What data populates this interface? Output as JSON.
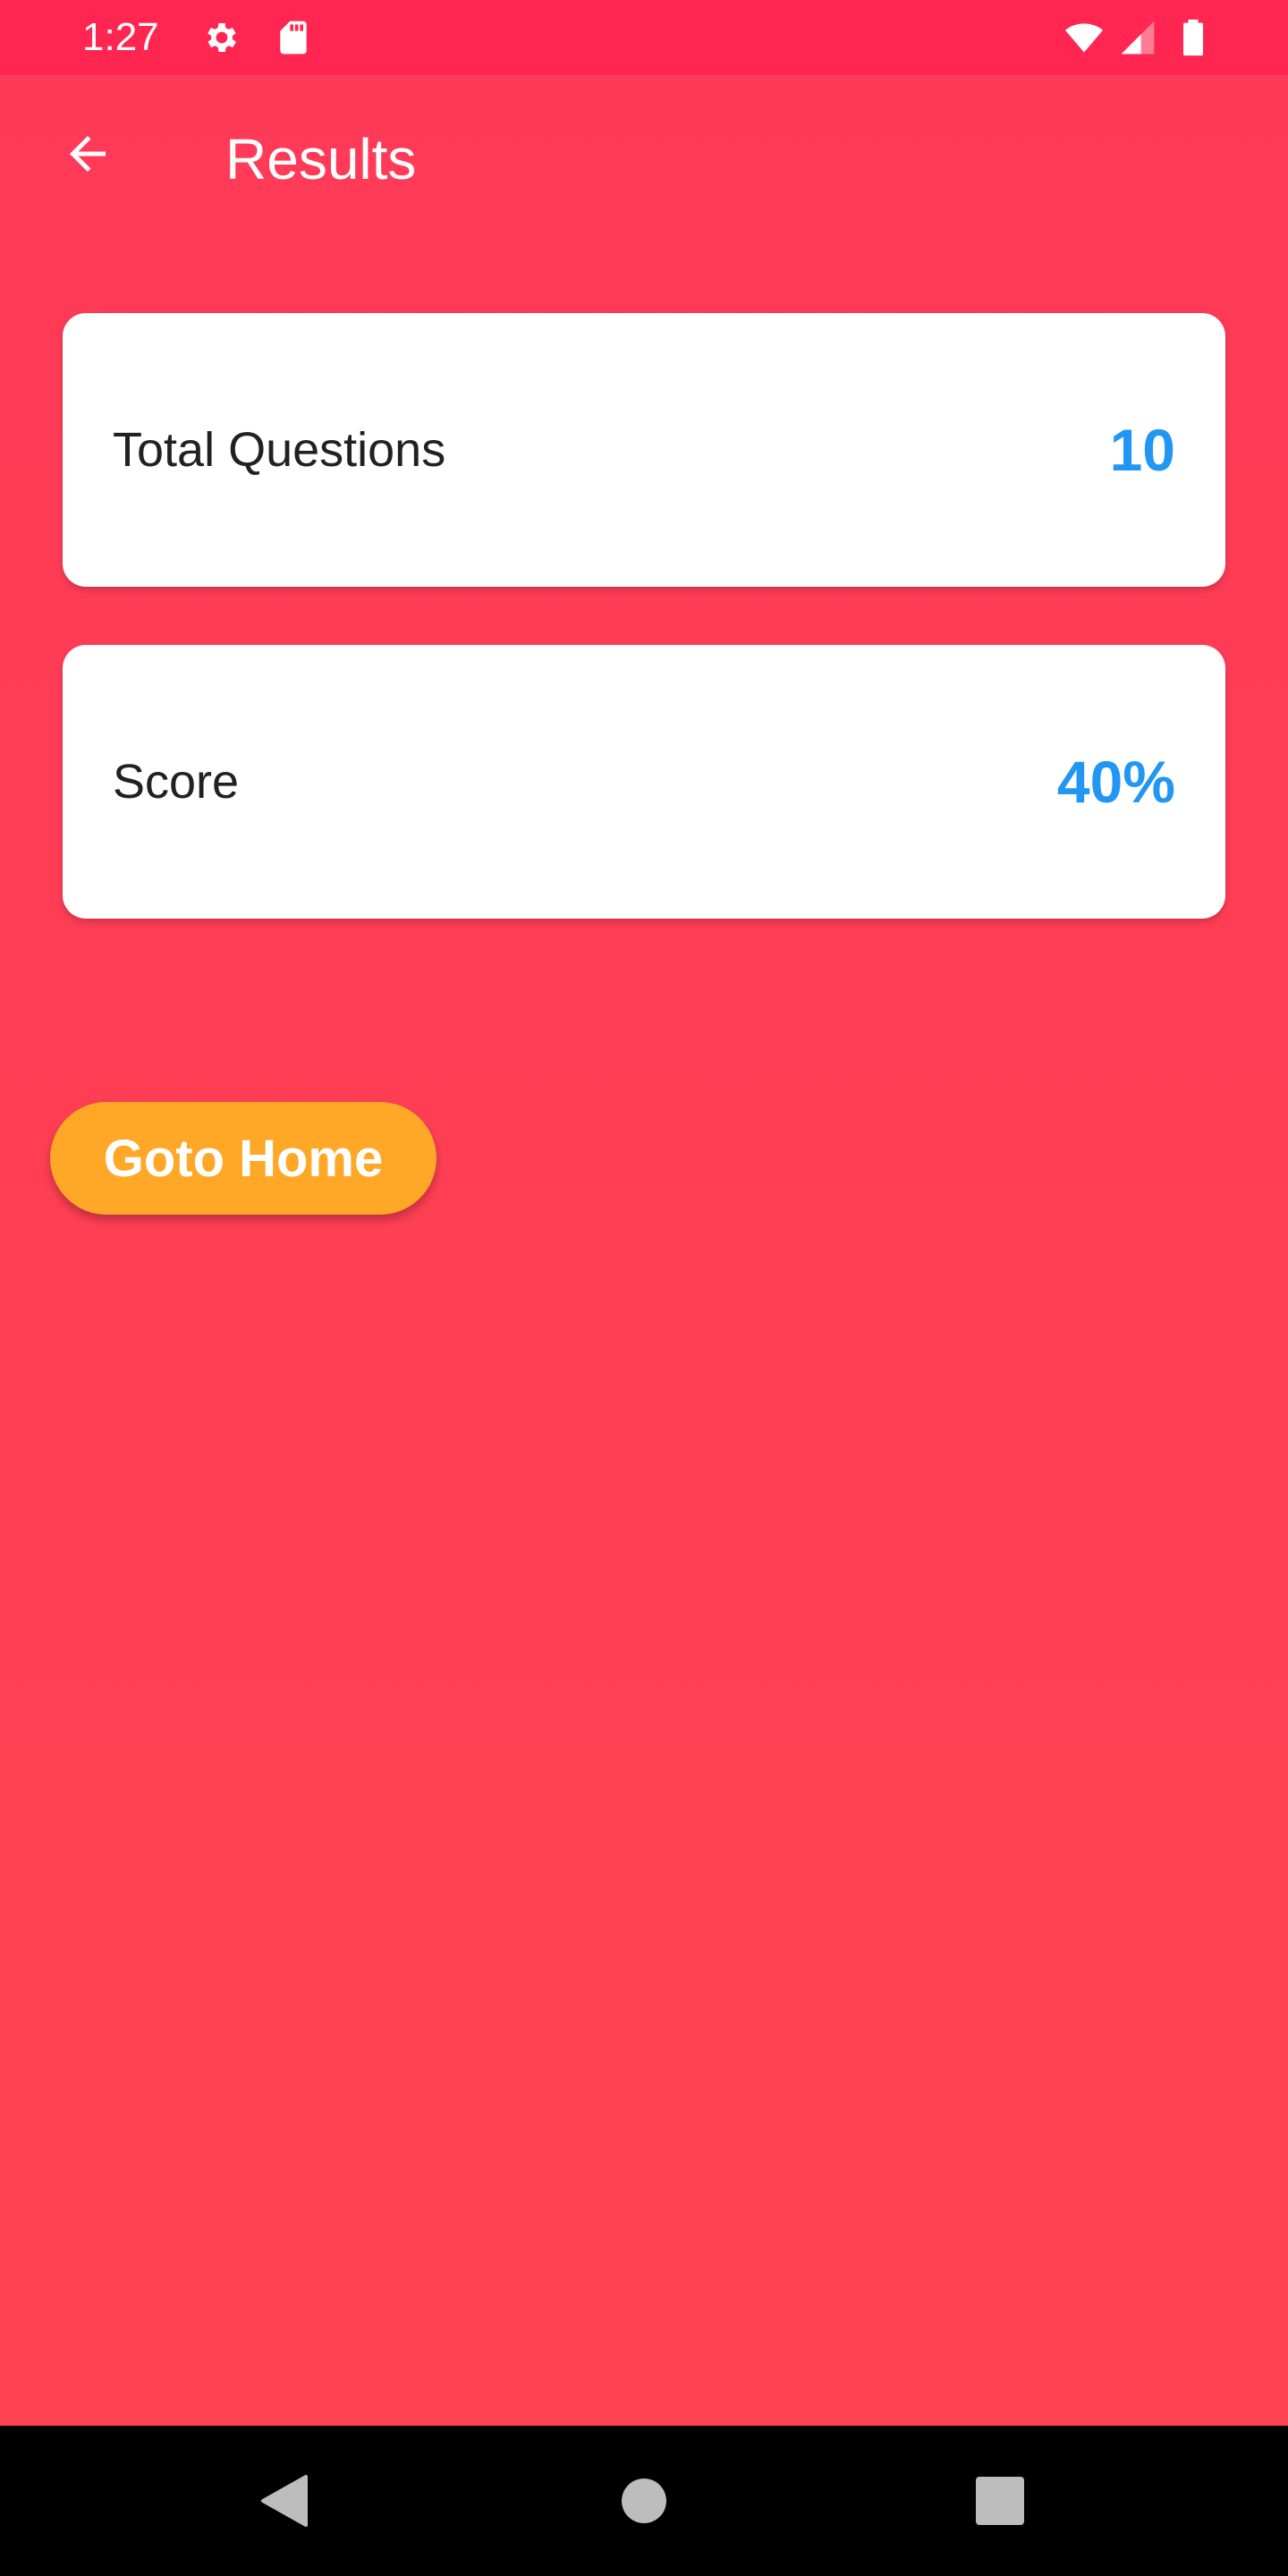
{
  "status_bar": {
    "time": "1:27",
    "icons": [
      "gear-icon",
      "sd-card-icon",
      "wifi-icon",
      "signal-icon",
      "battery-icon"
    ],
    "background": "#ff2651"
  },
  "app_bar": {
    "back_icon": "arrow-left-icon",
    "title": "Results"
  },
  "results": [
    {
      "label": "Total Questions",
      "value": "10"
    },
    {
      "label": "Score",
      "value": "40%"
    }
  ],
  "actions": {
    "home_button_label": "Goto Home"
  },
  "navigation_bar": {
    "icons": [
      "back-triangle-icon",
      "home-circle-icon",
      "recents-square-icon"
    ]
  },
  "colors": {
    "background_top": "#ff3a58",
    "background_bottom": "#ff4450",
    "accent_value": "#2196f3",
    "button": "#ffa726",
    "card": "#ffffff"
  }
}
